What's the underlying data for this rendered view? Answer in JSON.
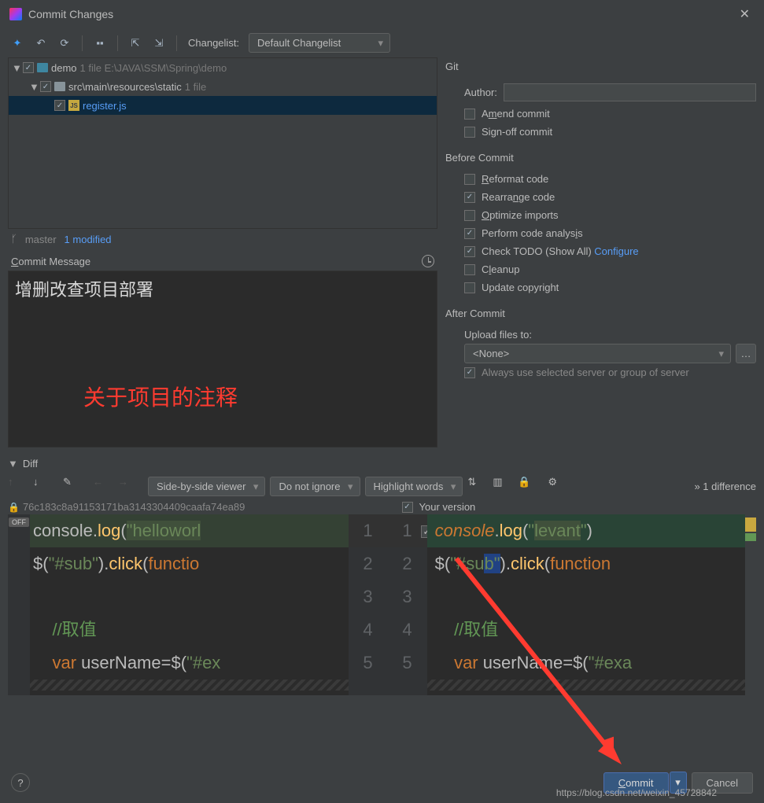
{
  "title": "Commit Changes",
  "toolbar": {
    "changelist_label": "Changelist:",
    "changelist_value": "Default Changelist"
  },
  "tree": {
    "root": {
      "name": "demo",
      "meta": "1 file  E:\\JAVA\\SSM\\Spring\\demo"
    },
    "child": {
      "name": "src\\main\\resources\\static",
      "meta": "1 file"
    },
    "leaf": {
      "name": "register.js"
    }
  },
  "status": {
    "branch": "master",
    "modified": "1 modified"
  },
  "commit": {
    "label_c": "C",
    "label_rest": "ommit Message",
    "text": "增删改查项目部署"
  },
  "overlay": "关于项目的注释",
  "git": {
    "title": "Git",
    "author_a": "A",
    "author_rest": "uthor:",
    "author_value": "",
    "amend_pre": "A",
    "amend_u": "m",
    "amend_post": "end commit",
    "sign_pre": "Si",
    "sign_u": "g",
    "sign_post": "n-off commit"
  },
  "before": {
    "title": "Before Commit",
    "items": [
      {
        "pre": "",
        "u": "R",
        "post": "eformat code",
        "checked": false
      },
      {
        "pre": "Rearra",
        "u": "n",
        "post": "ge code",
        "checked": true
      },
      {
        "pre": "",
        "u": "O",
        "post": "ptimize imports",
        "checked": false
      },
      {
        "pre": "Perform code analys",
        "u": "i",
        "post": "s",
        "checked": true
      },
      {
        "pre": "Check TODO (Show All) ",
        "u": "",
        "post": "",
        "checked": true,
        "link": "Configure"
      },
      {
        "pre": "C",
        "u": "l",
        "post": "eanup",
        "checked": false
      },
      {
        "pre": "Update copyright",
        "u": "",
        "post": "",
        "checked": false
      }
    ]
  },
  "after": {
    "title": "After Commit",
    "upload_label": "Upload files to:",
    "upload_value": "<None>",
    "cut_text": "Always use selected server or group of server"
  },
  "diff": {
    "label": "Diff",
    "viewer": "Side-by-side viewer",
    "ignore": "Do not ignore",
    "highlight": "Highlight words",
    "count": "1 difference",
    "hash": "76c183c8a91153171ba3143304409caafa74ea89",
    "your": "Your version",
    "off": "OFF"
  },
  "left_code": {
    "l1_a": "console.",
    "l1_b": "log",
    "l1_c": "(",
    "l1_d": "\"helloworl",
    "l2_a": "$(",
    "l2_b": "\"#sub\"",
    "l2_c": ").",
    "l2_d": "click",
    "l2_e": "(",
    "l2_f": "functio",
    "l4": "//取值",
    "l5_a": "var",
    "l5_b": " userName=$(",
    "l5_c": "\"#ex"
  },
  "right_code": {
    "l1_a": "console",
    "l1_b": ".",
    "l1_c": "log",
    "l1_d": "(",
    "l1_e": "\"",
    "l1_f": "levant",
    "l1_g": "\"",
    "l1_h": ")",
    "l2_a": "$(",
    "l2_b": "\"#su",
    "l2_c": "b\"",
    "l2_d": ").",
    "l2_e": "click",
    "l2_f": "(",
    "l2_g": "function",
    "l4": "//取值",
    "l5_a": "var",
    "l5_b": " userName=$(",
    "l5_c": "\"#exa"
  },
  "lines": [
    "1",
    "2",
    "3",
    "4",
    "5"
  ],
  "buttons": {
    "commit": "Commit",
    "cancel": "Cancel"
  },
  "watermark": "https://blog.csdn.net/weixin_45728842"
}
